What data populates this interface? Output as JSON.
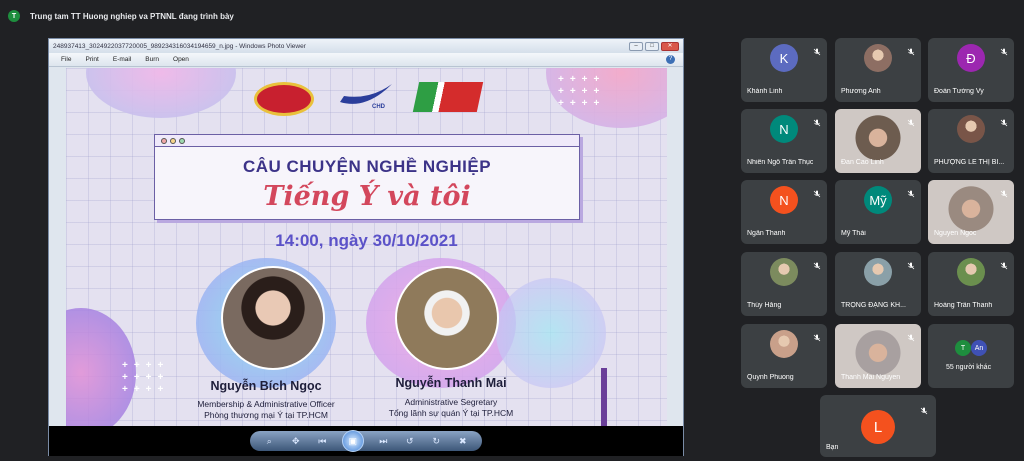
{
  "meet": {
    "presenter_initial": "T",
    "presenting_label": "Trung tam TT Huong nghiep va PTNNL đang trình bày",
    "others_count_label": "55 người khác",
    "others_initials": [
      "T",
      "An"
    ],
    "self_label": "Bạn",
    "self_initial": "L"
  },
  "viewer": {
    "title": "248937413_3024922037720005_989234316034194659_n.jpg - Windows Photo Viewer",
    "menu": [
      "File",
      "Print",
      "E-mail",
      "Burn",
      "Open"
    ],
    "help": "?"
  },
  "slide": {
    "headline1": "CÂU CHUYỆN NGHỀ NGHIỆP",
    "headline2": "Tiếng Ý và tôi",
    "datetime": "14:00, ngày 30/10/2021",
    "logo_text": "CHD",
    "speakers": [
      {
        "name": "Nguyễn Bích Ngọc",
        "role1": "Membership & Administrative Officer",
        "role2": "Phòng thương mại Ý tại TP.HCM"
      },
      {
        "name": "Nguyễn Thanh Mai",
        "role1": "Administrative Segretary",
        "role2": "Tổng lãnh sự quán Ý tại TP.HCM"
      }
    ]
  },
  "participants": [
    {
      "name": "Khánh Linh",
      "initial": "K",
      "color": "#5c6bc0",
      "kind": "avatar"
    },
    {
      "name": "Phương Anh",
      "initial": "",
      "color": "#8d6e63",
      "kind": "photo"
    },
    {
      "name": "Đoàn Tường Vy",
      "initial": "Đ",
      "color": "#9c27b0",
      "kind": "avatar"
    },
    {
      "name": "Nhiên Ngô Trần Thục",
      "initial": "N",
      "color": "#00897b",
      "kind": "avatar"
    },
    {
      "name": "Đan Cao Linh",
      "initial": "",
      "color": "#6d5c4f",
      "kind": "video"
    },
    {
      "name": "PHƯỢNG LÊ THỊ BÍ...",
      "initial": "",
      "color": "#795548",
      "kind": "photo"
    },
    {
      "name": "Ngân Thanh",
      "initial": "N",
      "color": "#f4511e",
      "kind": "avatar"
    },
    {
      "name": "Mỹ Thái",
      "initial": "Mỹ",
      "color": "#00897b",
      "kind": "avatar"
    },
    {
      "name": "Nguyen Ngoc",
      "initial": "",
      "color": "#9a8a80",
      "kind": "video"
    },
    {
      "name": "Thúy Hằng",
      "initial": "",
      "color": "#7c8b5e",
      "kind": "photo"
    },
    {
      "name": "TRỌNG ĐẶNG KH...",
      "initial": "",
      "color": "#8aa0a8",
      "kind": "photo"
    },
    {
      "name": "Hoàng Trần Thanh",
      "initial": "",
      "color": "#6b8f4e",
      "kind": "photo"
    },
    {
      "name": "Quynh Phuong",
      "initial": "",
      "color": "#c9a08a",
      "kind": "photo"
    },
    {
      "name": "Thanh Mai Nguyen",
      "initial": "",
      "color": "#a8a0a0",
      "kind": "video"
    }
  ],
  "colors": {
    "tile_bg": "#3c4043",
    "meet_bg": "#202124",
    "slide_purple": "#3c3388",
    "slide_red": "#d3475c"
  }
}
